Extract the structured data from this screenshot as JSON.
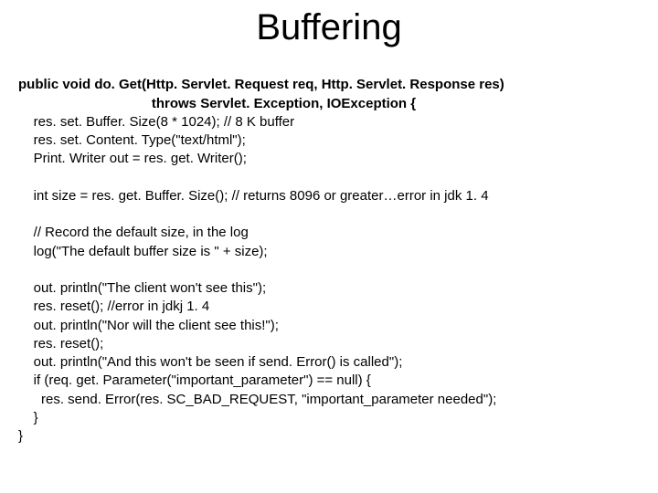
{
  "title": "Buffering",
  "code": {
    "l1": "public void do. Get(Http. Servlet. Request req, Http. Servlet. Response res)",
    "l2": "                                   throws Servlet. Exception, IOException {",
    "l3": "    res. set. Buffer. Size(8 * 1024); // 8 K buffer",
    "l4": "    res. set. Content. Type(\"text/html\");",
    "l5": "    Print. Writer out = res. get. Writer();",
    "l6": "",
    "l7": "    int size = res. get. Buffer. Size(); // returns 8096 or greater…error in jdk 1. 4",
    "l8": "",
    "l9": "    // Record the default size, in the log",
    "l10": "    log(\"The default buffer size is \" + size);",
    "l11": "",
    "l12": "    out. println(\"The client won't see this\");",
    "l13": "    res. reset(); //error in jdkj 1. 4",
    "l14": "    out. println(\"Nor will the client see this!\");",
    "l15": "    res. reset();",
    "l16": "    out. println(\"And this won't be seen if send. Error() is called\");",
    "l17": "    if (req. get. Parameter(\"important_parameter\") == null) {",
    "l18": "      res. send. Error(res. SC_BAD_REQUEST, \"important_parameter needed\");",
    "l19": "    }",
    "l20": "}"
  }
}
